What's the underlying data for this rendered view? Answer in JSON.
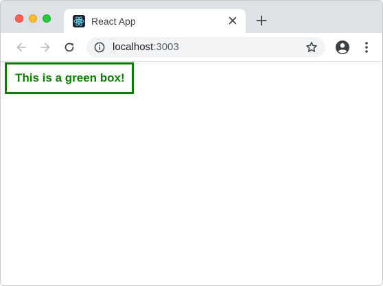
{
  "tab": {
    "title": "React App",
    "favicon": "react-logo-icon",
    "close": "close-icon"
  },
  "new_tab": "plus-icon",
  "toolbar": {
    "back": "arrow-left-icon",
    "forward": "arrow-right-icon",
    "reload": "reload-icon",
    "url_host": "localhost",
    "url_port": ":3003",
    "info": "info-icon",
    "bookmark": "star-icon",
    "profile": "account-icon",
    "menu": "more-vertical-icon"
  },
  "page": {
    "box_text": "This is a green box!"
  },
  "colors": {
    "green": "#0a8000",
    "tabstrip": "#dee1e6",
    "omnibox": "#f1f3f4"
  }
}
